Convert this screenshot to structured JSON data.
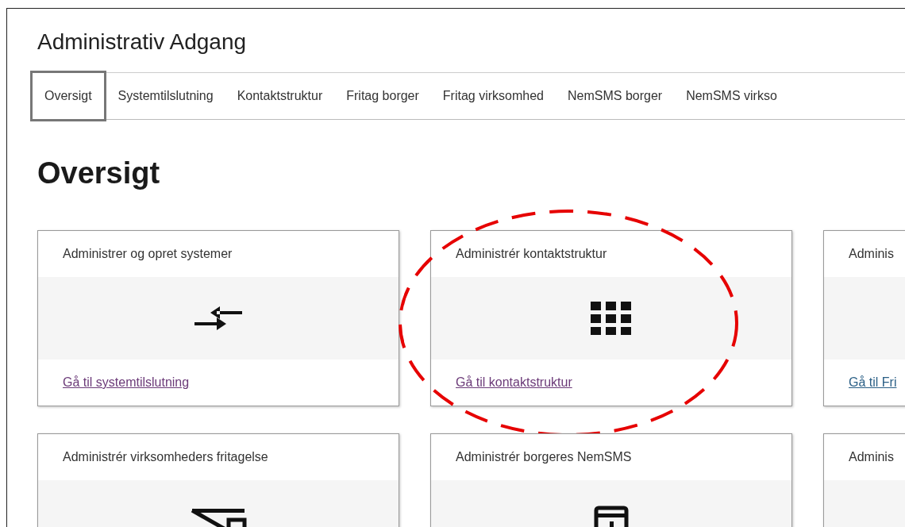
{
  "page_title": "Administrativ Adgang",
  "tabs": [
    {
      "label": "Oversigt",
      "selected": true
    },
    {
      "label": "Systemtilslutning",
      "selected": false
    },
    {
      "label": "Kontaktstruktur",
      "selected": false
    },
    {
      "label": "Fritag borger",
      "selected": false
    },
    {
      "label": "Fritag virksomhed",
      "selected": false
    },
    {
      "label": "NemSMS borger",
      "selected": false
    },
    {
      "label": "NemSMS virkso",
      "selected": false
    }
  ],
  "heading": "Oversigt",
  "cards": [
    {
      "title": "Administrer og opret systemer",
      "kind": "arrows",
      "link": "Gå til systemtilslutning",
      "visited": true,
      "circled": false
    },
    {
      "title": "Administrér kontaktstruktur",
      "kind": "grid",
      "link": "Gå til kontaktstruktur",
      "visited": true,
      "circled": true
    },
    {
      "title": "Adminis",
      "kind": "plain",
      "link": "Gå til Fri",
      "visited": false,
      "circled": false
    },
    {
      "title": "Administrér virksomheders fritagelse",
      "kind": "crossed",
      "circled": false
    },
    {
      "title": "Administrér borgeres NemSMS",
      "kind": "device",
      "circled": false
    },
    {
      "title": "Adminis",
      "kind": "plain",
      "circled": false
    }
  ]
}
